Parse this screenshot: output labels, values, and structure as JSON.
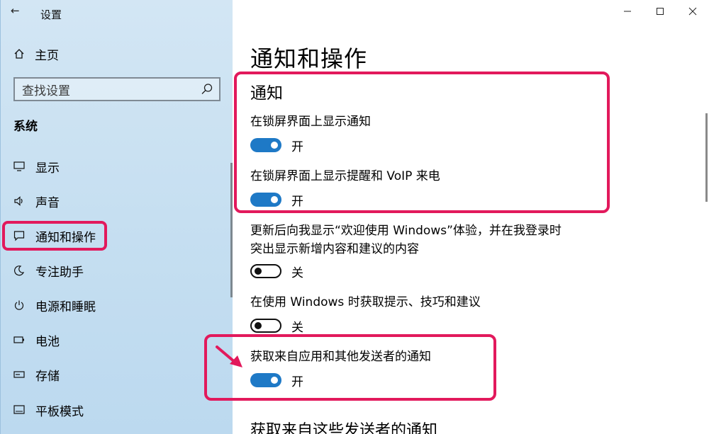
{
  "window": {
    "title": "设置",
    "back_icon": "back-arrow-icon"
  },
  "sidebar": {
    "home_label": "主页",
    "search_placeholder": "查找设置",
    "section_heading": "系统",
    "items": [
      {
        "label": "显示",
        "icon": "monitor-icon"
      },
      {
        "label": "声音",
        "icon": "speaker-icon"
      },
      {
        "label": "通知和操作",
        "icon": "notification-icon",
        "highlighted": true
      },
      {
        "label": "专注助手",
        "icon": "moon-icon"
      },
      {
        "label": "电源和睡眠",
        "icon": "power-icon"
      },
      {
        "label": "电池",
        "icon": "battery-icon"
      },
      {
        "label": "存储",
        "icon": "storage-icon"
      },
      {
        "label": "平板模式",
        "icon": "tablet-icon"
      }
    ]
  },
  "main": {
    "page_title": "通知和操作",
    "group_title": "通知",
    "settings": [
      {
        "label": "在锁屏界面上显示通知",
        "state": "开",
        "on": true
      },
      {
        "label": "在锁屏界面上显示提醒和 VoIP 来电",
        "state": "开",
        "on": true
      },
      {
        "label": "更新后向我显示“欢迎使用 Windows”体验，并在我登录时突出显示新增内容和建议的内容",
        "state": "关",
        "on": false
      },
      {
        "label": "在使用 Windows 时获取提示、技巧和建议",
        "state": "关",
        "on": false
      },
      {
        "label": "获取来自应用和其他发送者的通知",
        "state": "开",
        "on": true
      }
    ],
    "bottom_heading": "获取来自这些发送者的通知"
  },
  "colors": {
    "accent": "#1e79c6",
    "highlight": "#e2195c",
    "sidebar_bg": "#c6dff1"
  }
}
